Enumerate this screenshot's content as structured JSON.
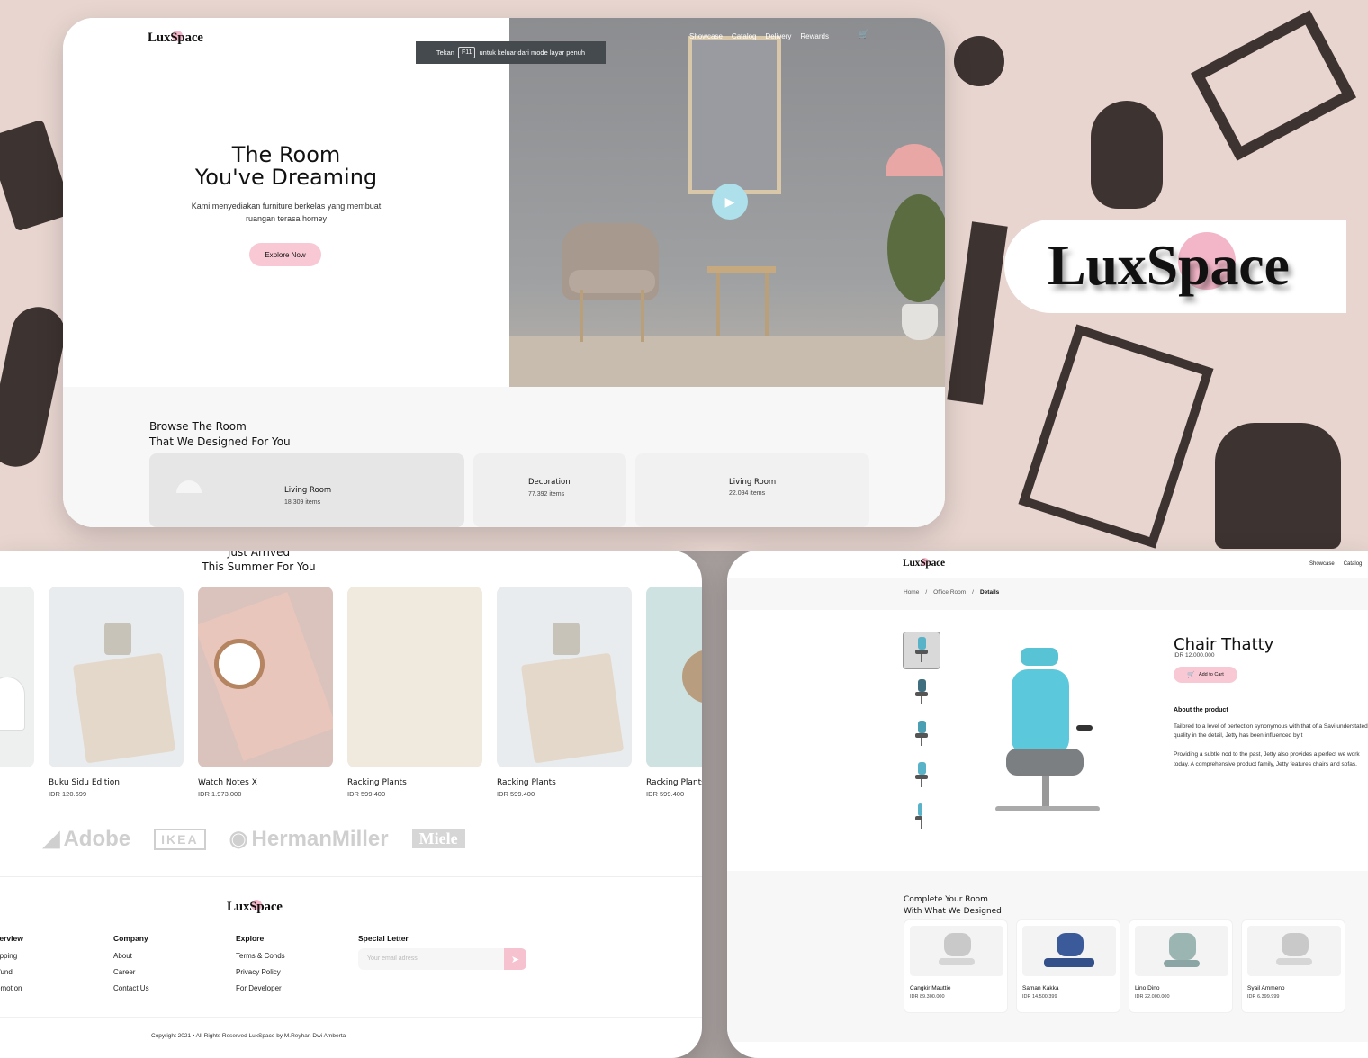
{
  "colors": {
    "accent_pink": "#f8c9d5",
    "bg_pink": "#e8d5d0",
    "icon_dark": "#3d3331",
    "play_blue": "#aee0ec"
  },
  "brand": {
    "logo": "LuxSpace"
  },
  "hero": {
    "nav": [
      "Showcase",
      "Catalog",
      "Delivery",
      "Rewards"
    ],
    "cart_icon": "cart-icon",
    "fullscreen": {
      "prefix": "Tekan",
      "key": "F11",
      "suffix": "untuk keluar dari mode layar penuh"
    },
    "title_line1": "The Room",
    "title_line2": "You've Dreaming",
    "subtitle": "Kami menyediakan furniture berkelas yang membuat ruangan terasa homey",
    "cta": "Explore Now",
    "browse_line1": "Browse The Room",
    "browse_line2": "That We Designed For You",
    "rooms": [
      {
        "name": "Living Room",
        "count": "18.309 items"
      },
      {
        "name": "Decoration",
        "count": "77.392 items"
      },
      {
        "name": "Living Room",
        "count": "22.094 items"
      }
    ]
  },
  "products_page": {
    "section_line1": "Just Arrived",
    "section_line2": "This Summer For You",
    "products": [
      {
        "name": "Buku Sidu Edition",
        "price": "IDR 120.699"
      },
      {
        "name": "Watch Notes X",
        "price": "IDR 1.973.000"
      },
      {
        "name": "Racking Plants",
        "price": "IDR 599.400"
      },
      {
        "name": "Racking Plants",
        "price": "IDR 599.400"
      },
      {
        "name": "Racking Plants",
        "price": "IDR 599.400"
      }
    ],
    "brands": [
      "Adobe",
      "IKEA",
      "HermanMiller",
      "Miele"
    ],
    "footer": {
      "col1": {
        "title": "Overview",
        "items": [
          "Shipping",
          "Refund",
          "Promotion"
        ]
      },
      "col2": {
        "title": "Company",
        "items": [
          "About",
          "Career",
          "Contact Us"
        ]
      },
      "col3": {
        "title": "Explore",
        "items": [
          "Terms & Conds",
          "Privacy Policy",
          "For Developer"
        ]
      },
      "col4": {
        "title": "Special Letter",
        "placeholder": "Your email adress"
      },
      "copyright": "Copyright 2021 • All Rights Reserved LuxSpace by M.Reyhan Dwi Amberta"
    }
  },
  "details_page": {
    "nav": [
      "Showcase",
      "Catalog"
    ],
    "breadcrumb": [
      "Home",
      "/",
      "Office Room",
      "/",
      "Details"
    ],
    "product_title": "Chair Thatty",
    "price": "IDR 12.000.000",
    "add_to_cart": "Add to Cart",
    "about_title": "About the product",
    "about_p1": "Tailored to a level of perfection synonymous with that of a Savi understated quality in the detail, Jetty has been influenced by t",
    "about_p2": "Providing a subtle nod to the past, Jetty also provides a perfect we work today. A comprehensive product family, Jetty features chairs and sofas.",
    "related_line1": "Complete Your Room",
    "related_line2": "With What We Designed",
    "related": [
      {
        "name": "Cangkir Mauttie",
        "price": "IDR 89.300.000"
      },
      {
        "name": "Saman Kakka",
        "price": "IDR 14.500.399"
      },
      {
        "name": "Lino Dino",
        "price": "IDR 22.000.000"
      },
      {
        "name": "Syail Ammeno",
        "price": "IDR 6.399.999"
      }
    ]
  }
}
